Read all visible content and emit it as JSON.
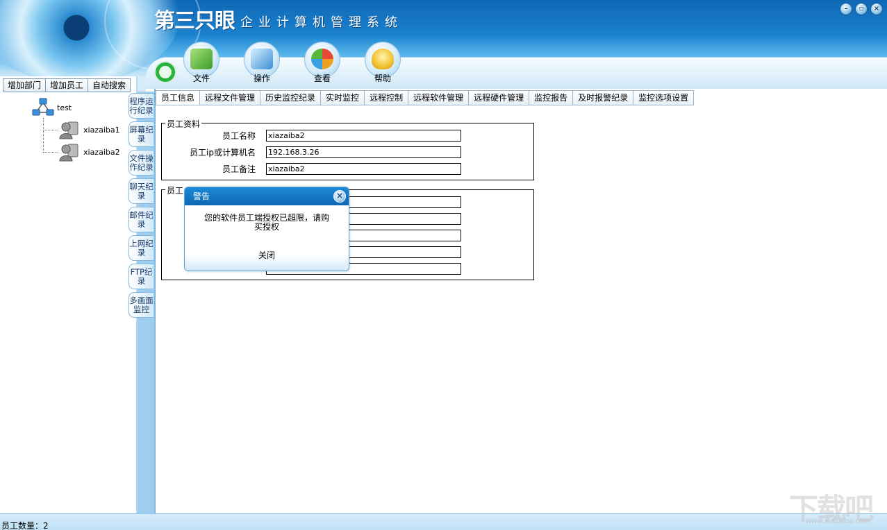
{
  "app": {
    "logo_text": "第三只眼",
    "title": "企业计算机管理系统",
    "window_buttons": [
      "minimize-icon",
      "restore-icon",
      "close-icon"
    ]
  },
  "toolbar": {
    "items": [
      {
        "label": "文件",
        "icon": "file-folder-icon",
        "color": "#56b837"
      },
      {
        "label": "操作",
        "icon": "operation-icon",
        "color": "#3b8fd6"
      },
      {
        "label": "查看",
        "icon": "view-icon",
        "color": "#f0a020"
      },
      {
        "label": "帮助",
        "icon": "help-lamp-icon",
        "color": "#f2c230"
      }
    ]
  },
  "left": {
    "buttons": [
      "增加部门",
      "增加员工",
      "自动搜索"
    ],
    "tree": {
      "root": "test",
      "children": [
        "xiazaiba1",
        "xiazaiba2"
      ]
    }
  },
  "vertical_tabs": [
    "程序运行纪录",
    "屏幕纪录",
    "文件操作纪录",
    "聊天纪录",
    "邮件纪录",
    "上网纪录",
    "FTP纪录",
    "多画面监控"
  ],
  "tabs": [
    "员工信息",
    "远程文件管理",
    "历史监控纪录",
    "实时监控",
    "远程控制",
    "远程软件管理",
    "远程硬件管理",
    "监控报告",
    "及时报警纪录",
    "监控选项设置"
  ],
  "employee": {
    "legend": "员工资料",
    "name_label": "员工名称",
    "name_value": "xiazaiba2",
    "ip_label": "员工ip或计算机名",
    "ip_value": "192.168.3.26",
    "note_label": "员工备注",
    "note_value": "xiazaiba2"
  },
  "group2": {
    "legend": "员工"
  },
  "dialog": {
    "title": "警告",
    "message_line1": "您的软件员工端授权已超限，请购",
    "message_line2": "买授权",
    "close_button": "关闭"
  },
  "status": {
    "employee_count": "员工数量：2"
  },
  "watermark": {
    "text": "下载吧",
    "sub": "www.xiazaiba.com"
  }
}
